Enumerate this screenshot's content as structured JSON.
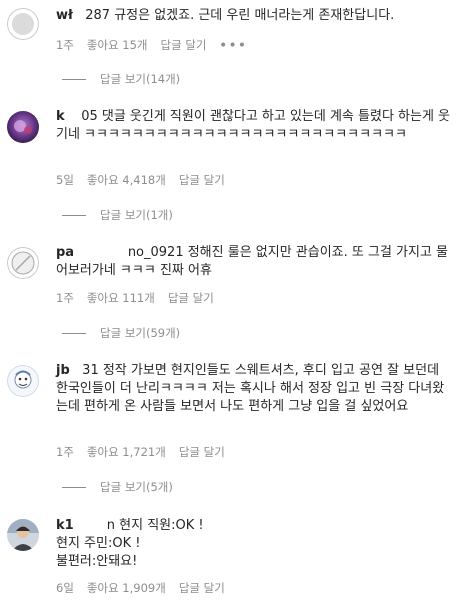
{
  "comments": [
    {
      "username": "wł",
      "text": "287 규정은 없겠죠. 근데 우린 매너라는게 존재한답니다.",
      "time": "1주",
      "likes": "좋아요 15개",
      "reply": "답글 달기",
      "more": "•••",
      "view_replies": "답글 보기(14개)",
      "avatar_icon": "default-avatar-icon"
    },
    {
      "username": "k",
      "text": "05 댓글 웃긴게 직원이 괜찮다고 하고 있는데 계속 틀렸다 하는게 웃기네 ㅋㅋㅋㅋㅋㅋㅋㅋㅋㅋㅋㅋㅋㅋㅋㅋㅋㅋㅋㅋㅋㅋㅋㅋㅋㅋㅋ",
      "time": "5일",
      "likes": "좋아요 4,418개",
      "reply": "답글 달기",
      "view_replies": "답글 보기(1개)",
      "avatar_icon": "purple-photo-avatar"
    },
    {
      "username": "pa",
      "text": "no_0921 정해진 룰은 없지만 관습이죠. 또 그걸 가지고 물어보러가네 ㅋㅋㅋ 진짜 어휴",
      "time": "1주",
      "likes": "좋아요 111개",
      "reply": "답글 달기",
      "view_replies": "답글 보기(59개)",
      "avatar_icon": "no-avatar-icon"
    },
    {
      "username": "jb",
      "text": "31 정작 가보면 현지인들도 스웨트셔츠, 후디 입고 공연 잘 보던데 한국인들이 더 난리ㅋㅋㅋㅋ 저는 혹시나 해서 정장 입고 빈 극장 다녀왔는데 편하게 온 사람들 보면서 나도 편하게 그냥 입을 걸 싶었어요",
      "time": "1주",
      "likes": "좋아요 1,721개",
      "reply": "답글 달기",
      "view_replies": "답글 보기(5개)",
      "avatar_icon": "cartoon-avatar-icon"
    },
    {
      "username": "k1",
      "text": "n 현지 직원:OK !\n현지 주민:OK !\n불편러:안돼요!",
      "time": "6일",
      "likes": "좋아요 1,909개",
      "reply": "답글 달기",
      "avatar_icon": "person-photo-avatar"
    }
  ],
  "colors": {
    "text": "#262626",
    "meta": "#8e8e8e",
    "background": "#ffffff"
  }
}
